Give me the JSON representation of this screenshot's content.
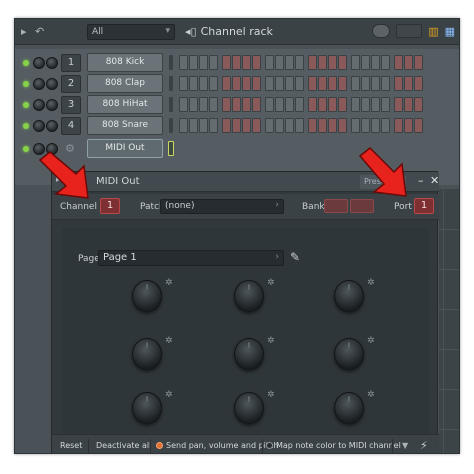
{
  "channel_rack": {
    "title": "Channel rack",
    "filter": "All",
    "channels": [
      {
        "number": "1",
        "name": "808 Kick"
      },
      {
        "number": "2",
        "name": "808 Clap"
      },
      {
        "number": "3",
        "name": "808 HiHat"
      },
      {
        "number": "4",
        "name": "808 Snare"
      },
      {
        "number": "",
        "name": "MIDI Out"
      }
    ]
  },
  "plugin": {
    "title": "MIDI Out",
    "presets_label": "Presets",
    "channel_label": "Channel",
    "channel_value": "1",
    "patch_label": "Patch",
    "patch_value": "(none)",
    "bank_label": "Bank",
    "port_label": "Port",
    "port_value": "1",
    "page_label": "Page",
    "page_value": "Page 1",
    "bottom": {
      "reset": "Reset",
      "deactivate_all": "Deactivate all",
      "send_pan": "Send pan, volume and pitch",
      "map_note": "Map note color to MIDI channel"
    }
  },
  "annotation_color": "#e8221c"
}
